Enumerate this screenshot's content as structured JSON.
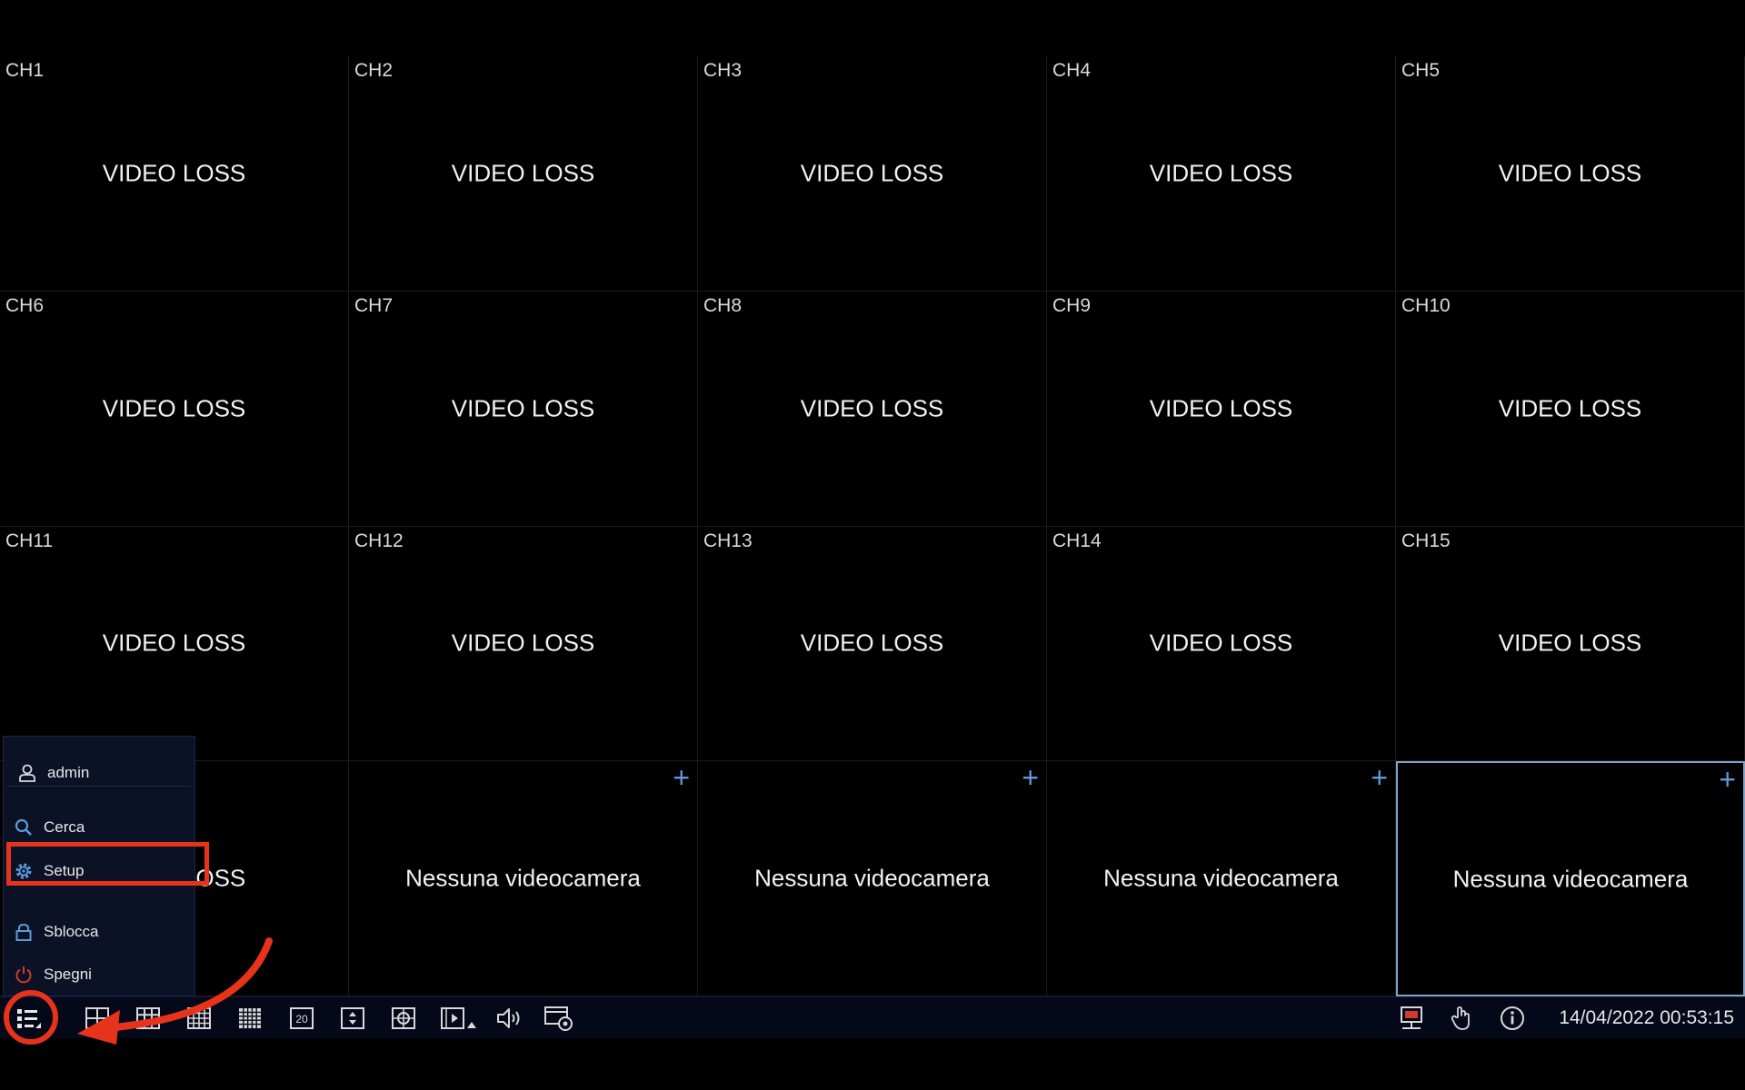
{
  "channels": [
    {
      "label": "CH1",
      "status": "VIDEO LOSS"
    },
    {
      "label": "CH2",
      "status": "VIDEO LOSS"
    },
    {
      "label": "CH3",
      "status": "VIDEO LOSS"
    },
    {
      "label": "CH4",
      "status": "VIDEO LOSS"
    },
    {
      "label": "CH5",
      "status": "VIDEO LOSS"
    },
    {
      "label": "CH6",
      "status": "VIDEO LOSS"
    },
    {
      "label": "CH7",
      "status": "VIDEO LOSS"
    },
    {
      "label": "CH8",
      "status": "VIDEO LOSS"
    },
    {
      "label": "CH9",
      "status": "VIDEO LOSS"
    },
    {
      "label": "CH10",
      "status": "VIDEO LOSS"
    },
    {
      "label": "CH11",
      "status": "VIDEO LOSS"
    },
    {
      "label": "CH12",
      "status": "VIDEO LOSS"
    },
    {
      "label": "CH13",
      "status": "VIDEO LOSS"
    },
    {
      "label": "CH14",
      "status": "VIDEO LOSS"
    },
    {
      "label": "CH15",
      "status": "VIDEO LOSS"
    },
    {
      "label": "",
      "status": "VIDEO LOSS"
    },
    {
      "label": "",
      "status": "Nessuna videocamera",
      "add": "+"
    },
    {
      "label": "",
      "status": "Nessuna videocamera",
      "add": "+"
    },
    {
      "label": "",
      "status": "Nessuna videocamera",
      "add": "+"
    },
    {
      "label": "",
      "status": "Nessuna videocamera",
      "add": "+",
      "selected": true
    }
  ],
  "menu": {
    "user": "admin",
    "search": "Cerca",
    "setup": "Setup",
    "unlock": "Sblocca",
    "shutdown": "Spegni"
  },
  "taskbar": {
    "layout_20_label": "20",
    "datetime": "14/04/2022 00:53:15"
  },
  "icons": {
    "main_menu": "menu-grid-icon",
    "layout_1": "single-view-icon",
    "layout_4": "quad-view-icon",
    "layout_9": "nine-view-icon",
    "layout_16": "sixteen-view-icon",
    "layout_25": "twentyfive-view-icon",
    "layout_20": "twenty-view-icon",
    "sequence": "sequence-icon",
    "ptz": "ptz-icon",
    "playback": "playback-icon",
    "volume": "volume-icon",
    "snapshot": "snapshot-icon",
    "network": "network-icon",
    "hand": "hand-icon",
    "info": "info-icon"
  },
  "colors": {
    "accent": "#5e9ad9",
    "annotation": "#e8331c",
    "taskbar_bg": "#040818",
    "menu_bg": "#0b1226",
    "shutdown": "#d23a2c"
  }
}
